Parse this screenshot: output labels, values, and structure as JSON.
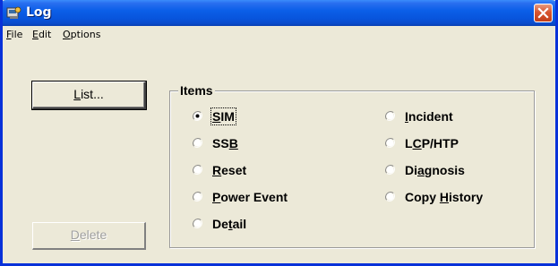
{
  "window": {
    "title": "Log",
    "icon": "log-app-icon",
    "close_icon": "close-icon"
  },
  "menu": {
    "file": {
      "pre": "",
      "u": "F",
      "post": "ile"
    },
    "edit": {
      "pre": "",
      "u": "E",
      "post": "dit"
    },
    "options": {
      "pre": "",
      "u": "O",
      "post": "ptions"
    }
  },
  "buttons": {
    "list": {
      "pre": "",
      "u": "L",
      "post": "ist..."
    },
    "delete": {
      "pre": "",
      "u": "D",
      "post": "elete",
      "enabled": false
    }
  },
  "items_group": {
    "label": "Items",
    "options": [
      {
        "pre": "",
        "u": "S",
        "post": "IM",
        "selected": true
      },
      {
        "pre": "SS",
        "u": "B",
        "post": "",
        "selected": false
      },
      {
        "pre": "",
        "u": "R",
        "post": "eset",
        "selected": false
      },
      {
        "pre": "",
        "u": "P",
        "post": "ower Event",
        "selected": false
      },
      {
        "pre": "De",
        "u": "t",
        "post": "ail",
        "selected": false
      },
      {
        "pre": "",
        "u": "I",
        "post": "ncident",
        "selected": false
      },
      {
        "pre": "L",
        "u": "C",
        "post": "P/HTP",
        "selected": false
      },
      {
        "pre": "Di",
        "u": "a",
        "post": "gnosis",
        "selected": false
      },
      {
        "pre": "Copy ",
        "u": "H",
        "post": "istory",
        "selected": false
      }
    ]
  },
  "colors": {
    "titlebar": "#0855dd",
    "window_bg": "#ece9d8",
    "close_button": "#d8552f"
  }
}
